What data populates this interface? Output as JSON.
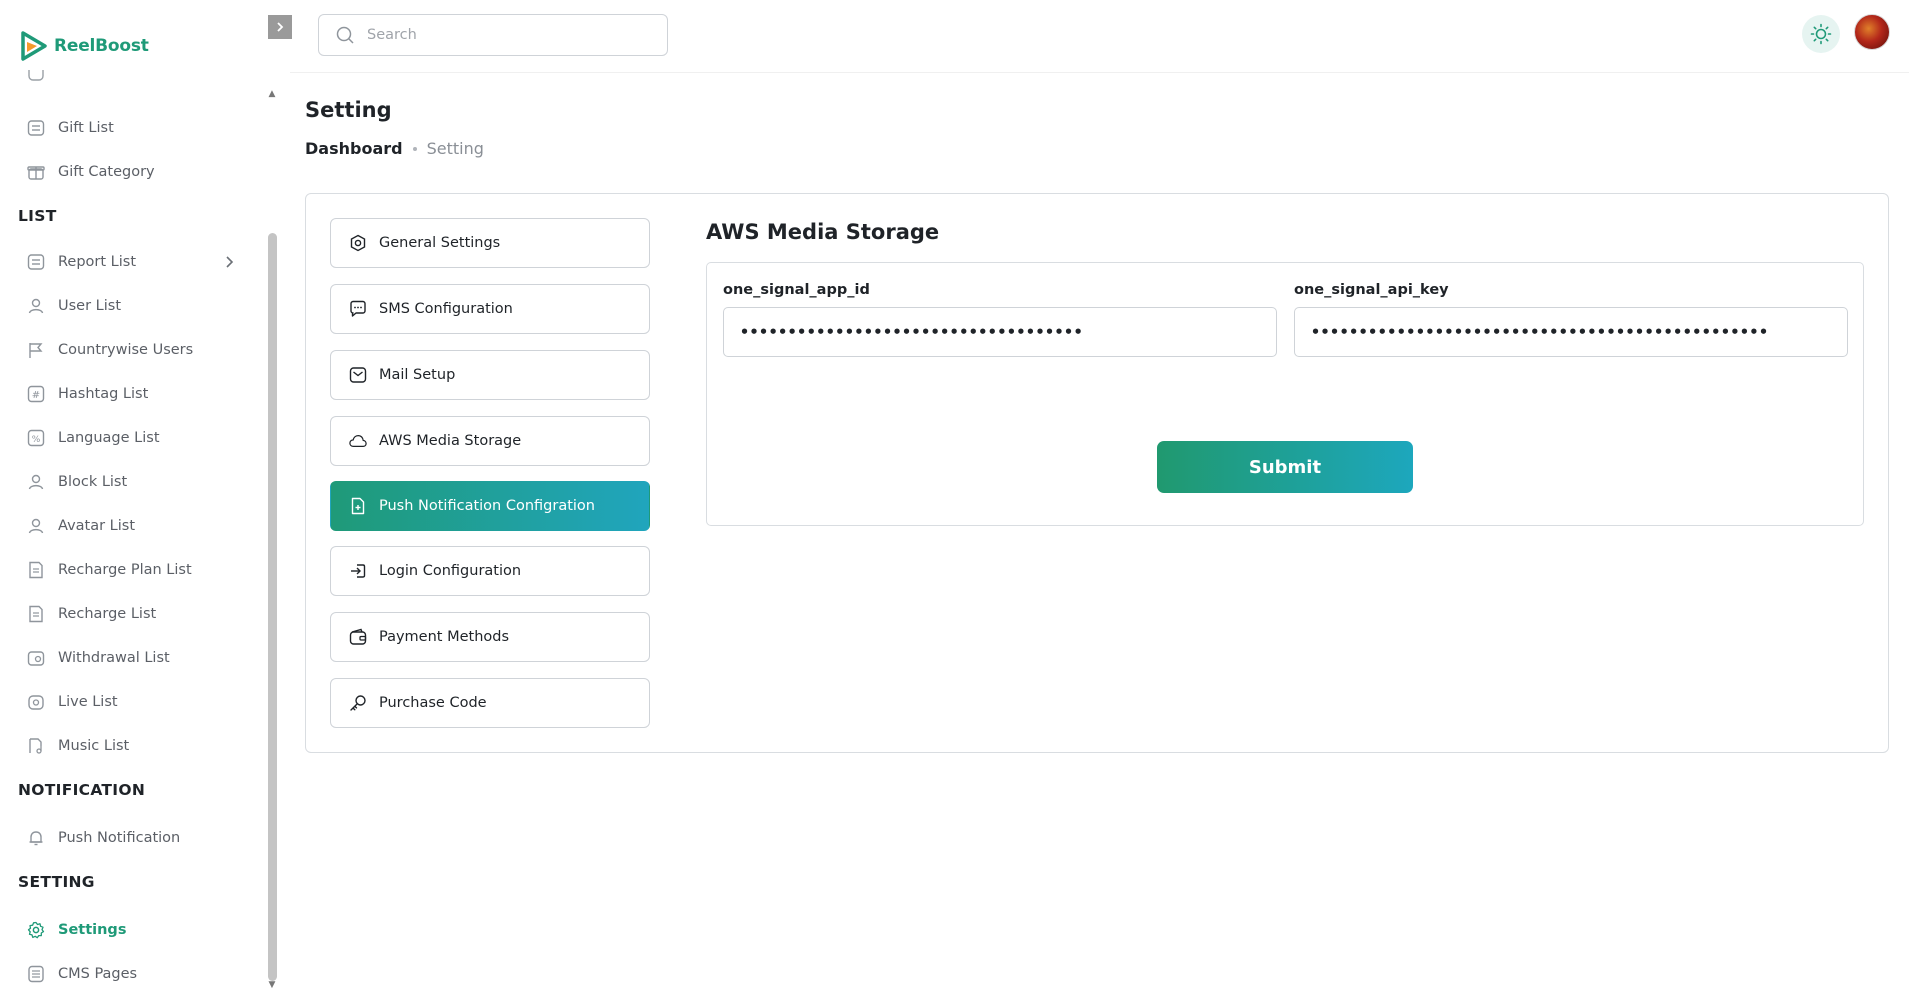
{
  "app": {
    "name": "ReelBoost"
  },
  "header": {
    "search_placeholder": "Search"
  },
  "sidebar": {
    "items_top": [
      {
        "label": "Gift List",
        "icon": "list-icon"
      },
      {
        "label": "Gift Category",
        "icon": "gift-icon"
      }
    ],
    "section_list": "LIST",
    "items_list": [
      {
        "label": "Report List",
        "icon": "list-icon"
      },
      {
        "label": "User List",
        "icon": "user-icon"
      },
      {
        "label": "Countrywise Users",
        "icon": "flag-icon"
      },
      {
        "label": "Hashtag List",
        "icon": "hashtag-icon"
      },
      {
        "label": "Language List",
        "icon": "language-icon"
      },
      {
        "label": "Block List",
        "icon": "user-icon"
      },
      {
        "label": "Avatar List",
        "icon": "user-icon"
      },
      {
        "label": "Recharge Plan List",
        "icon": "receipt-icon"
      },
      {
        "label": "Recharge List",
        "icon": "receipt-icon"
      },
      {
        "label": "Withdrawal List",
        "icon": "withdraw-icon"
      },
      {
        "label": "Live List",
        "icon": "live-icon"
      },
      {
        "label": "Music List",
        "icon": "music-icon"
      }
    ],
    "section_notification": "NOTIFICATION",
    "items_notification": [
      {
        "label": "Push Notification",
        "icon": "bell-icon"
      }
    ],
    "section_setting": "SETTING",
    "items_setting": [
      {
        "label": "Settings",
        "icon": "gear-icon",
        "active": true
      },
      {
        "label": "CMS Pages",
        "icon": "document-icon"
      }
    ]
  },
  "page": {
    "title": "Setting",
    "breadcrumb": {
      "home": "Dashboard",
      "current": "Setting"
    }
  },
  "settings_tabs": [
    {
      "label": "General Settings",
      "icon": "hexagon-gear-icon"
    },
    {
      "label": "SMS Configuration",
      "icon": "chat-icon"
    },
    {
      "label": "Mail Setup",
      "icon": "mail-icon"
    },
    {
      "label": "AWS Media Storage",
      "icon": "cloud-icon"
    },
    {
      "label": "Push Notification Configration",
      "icon": "file-plus-icon",
      "active": true
    },
    {
      "label": "Login Configuration",
      "icon": "login-icon"
    },
    {
      "label": "Payment Methods",
      "icon": "wallet-icon"
    },
    {
      "label": "Purchase Code",
      "icon": "key-icon"
    }
  ],
  "panel": {
    "title": "AWS Media Storage",
    "fields": [
      {
        "label": "one_signal_app_id",
        "value": "••••••••••••••••••••••••••••••••••••"
      },
      {
        "label": "one_signal_api_key",
        "value": "••••••••••••••••••••••••••••••••••••••••••••••••"
      }
    ],
    "submit_label": "Submit"
  },
  "colors": {
    "brand": "#1f9a78",
    "gradient_start": "#1f9a78",
    "gradient_end": "#20a5bd"
  }
}
